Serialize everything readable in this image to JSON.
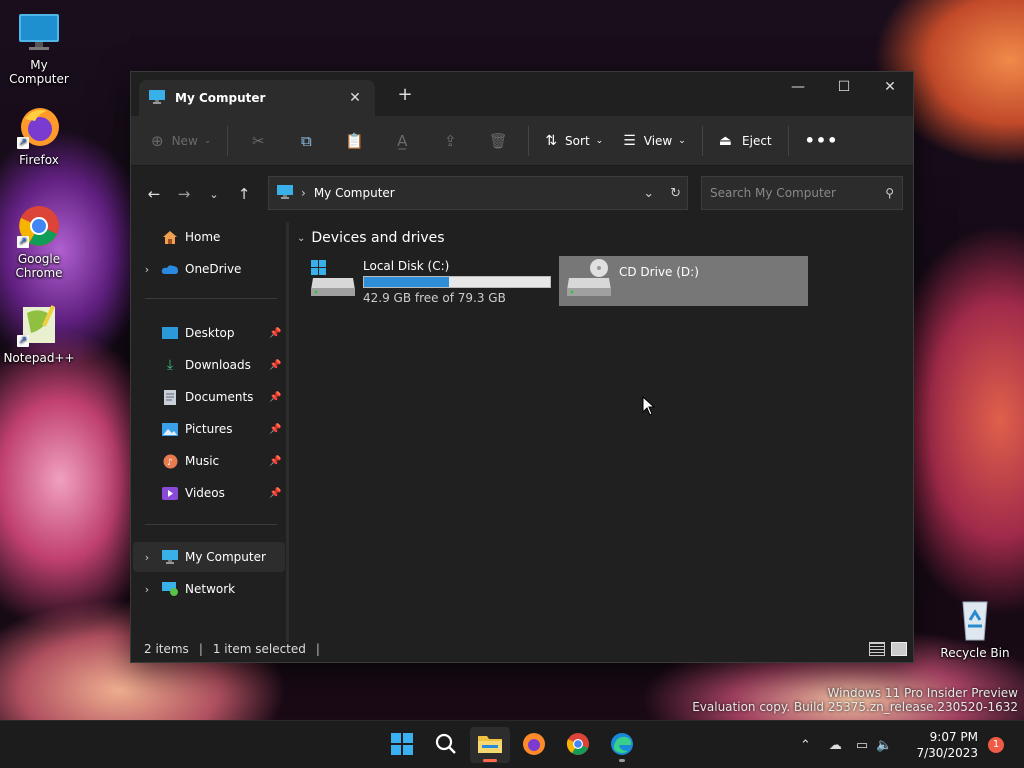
{
  "desktop": {
    "icons": [
      {
        "label": "My Computer"
      },
      {
        "label": "Firefox"
      },
      {
        "label": "Google Chrome"
      },
      {
        "label": "Notepad++"
      },
      {
        "label": "Recycle Bin"
      }
    ]
  },
  "window": {
    "tab_title": "My Computer",
    "toolbar": {
      "new_label": "New",
      "sort_label": "Sort",
      "view_label": "View",
      "eject_label": "Eject"
    },
    "address": {
      "crumb": "My Computer"
    },
    "search": {
      "placeholder": "Search My Computer"
    },
    "sidebar": {
      "items": [
        {
          "label": "Home",
          "icon": "home-icon"
        },
        {
          "label": "OneDrive",
          "icon": "onedrive-icon"
        },
        {
          "label": "Desktop",
          "icon": "desktop-icon"
        },
        {
          "label": "Downloads",
          "icon": "downloads-icon"
        },
        {
          "label": "Documents",
          "icon": "documents-icon"
        },
        {
          "label": "Pictures",
          "icon": "pictures-icon"
        },
        {
          "label": "Music",
          "icon": "music-icon"
        },
        {
          "label": "Videos",
          "icon": "videos-icon"
        },
        {
          "label": "My Computer",
          "icon": "computer-icon"
        },
        {
          "label": "Network",
          "icon": "network-icon"
        }
      ]
    },
    "content": {
      "group_title": "Devices and drives",
      "drives": [
        {
          "name": "Local Disk (C:)",
          "free_text": "42.9 GB free of 79.3 GB",
          "used_fraction": 0.459
        },
        {
          "name": "CD Drive (D:)"
        }
      ]
    },
    "status": {
      "items_count": "2 items",
      "selection": "1 item selected"
    }
  },
  "watermark": {
    "line1": "Windows 11 Pro Insider Preview",
    "line2": "Evaluation copy. Build 25375.zn_release.230520-1632"
  },
  "taskbar": {
    "time": "9:07 PM",
    "date": "7/30/2023",
    "notification_count": "1"
  },
  "colors": {
    "accent": "#2e8fd8",
    "notification": "#f05b45",
    "window_bg": "#202020"
  }
}
